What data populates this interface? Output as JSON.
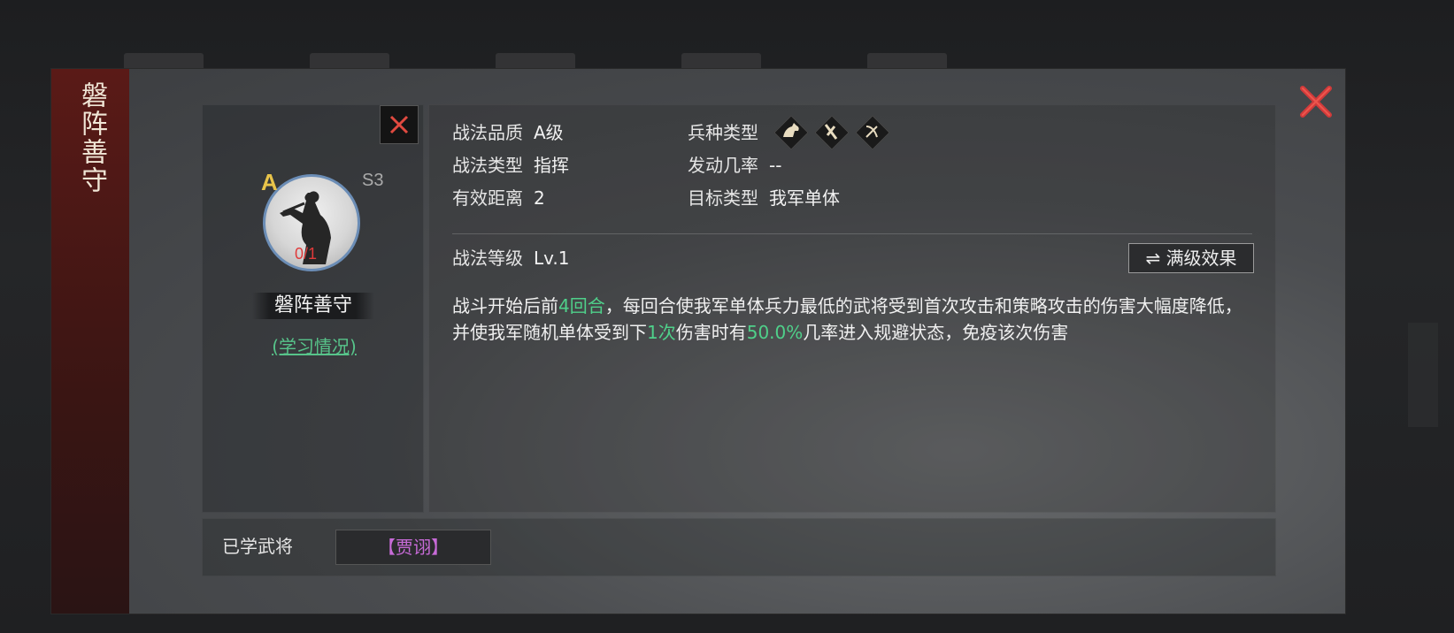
{
  "dialog": {
    "side_title": "磐阵善守"
  },
  "tactic": {
    "grade": "A",
    "season": "S3",
    "progress": "0/1",
    "name": "磐阵善守",
    "learn_link": "(学习情况)"
  },
  "attributes": {
    "quality_label": "战法品质",
    "quality_value": "A级",
    "type_label": "战法类型",
    "type_value": "指挥",
    "range_label": "有效距离",
    "range_value": "2",
    "troop_label": "兵种类型",
    "troop_icons": [
      "cavalry-icon",
      "shield-icon",
      "archer-icon"
    ],
    "trigger_label": "发动几率",
    "trigger_value": "--",
    "target_label": "目标类型",
    "target_value": "我军单体"
  },
  "level": {
    "label": "战法等级",
    "value": "Lv.1",
    "max_button": "满级效果"
  },
  "description": {
    "p1": "战斗开始后前",
    "h1": "4回合",
    "p2": "，每回合使我军单体兵力最低的武将受到首次攻击和策略攻击的伤害大幅度降低，并使我军随机单体受到下",
    "h2": "1次",
    "p3": "伤害时有",
    "h3": "50.0%",
    "p4": "几率进入规避状态，免疫该次伤害"
  },
  "learned": {
    "label": "已学武将",
    "general": "【贾诩】"
  },
  "colors": {
    "highlight": "#4fd08a",
    "grade": "#e8c44a",
    "progress": "#e03a3a",
    "general": "#c86bd8",
    "close": "#d23a3a"
  }
}
